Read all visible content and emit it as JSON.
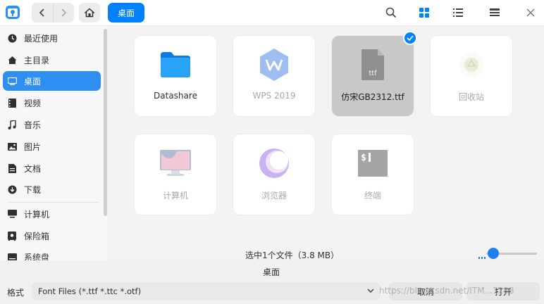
{
  "toolbar": {
    "breadcrumb": "桌面",
    "icons": [
      "app-logo-icon",
      "back-icon",
      "forward-icon",
      "home-icon",
      "search-icon",
      "icon-view-icon",
      "list-view-icon",
      "detail-view-icon",
      "close-icon"
    ],
    "accent": "#0081ff"
  },
  "sidebar": {
    "items": [
      {
        "label": "最近使用",
        "icon": "clock-icon"
      },
      {
        "label": "主目录",
        "icon": "home-icon"
      },
      {
        "label": "桌面",
        "icon": "desktop-icon",
        "active": true
      },
      {
        "label": "视频",
        "icon": "video-icon"
      },
      {
        "label": "音乐",
        "icon": "music-icon"
      },
      {
        "label": "图片",
        "icon": "picture-icon"
      },
      {
        "label": "文档",
        "icon": "document-icon"
      },
      {
        "label": "下载",
        "icon": "download-icon"
      },
      {
        "label": "计算机",
        "icon": "computer-icon"
      },
      {
        "label": "保险箱",
        "icon": "safe-icon"
      },
      {
        "label": "系统盘",
        "icon": "disk-icon"
      }
    ]
  },
  "files": [
    {
      "label": "Datashare",
      "icon": "folder-icon"
    },
    {
      "label": "WPS 2019",
      "icon": "wps-icon",
      "dim": true
    },
    {
      "label": "仿宋GB2312.ttf",
      "icon": "ttf-file-icon",
      "selected": true
    },
    {
      "label": "回收站",
      "icon": "trash-icon",
      "dim": true
    },
    {
      "label": "计算机",
      "icon": "computer-icon",
      "dim": true
    },
    {
      "label": "浏览器",
      "icon": "browser-icon",
      "dim": true
    },
    {
      "label": "终端",
      "icon": "terminal-icon",
      "dim": true
    }
  ],
  "status": {
    "text": "选中1个文件（3.8 MB）"
  },
  "footer": {
    "filename": "桌面",
    "format_label": "格式",
    "format_value": "Font Files (*.ttf *.ttc *.otf)",
    "cancel": "取消",
    "open": "打开",
    "watermark": "https://blog.csdn.net/ITM...1208"
  }
}
